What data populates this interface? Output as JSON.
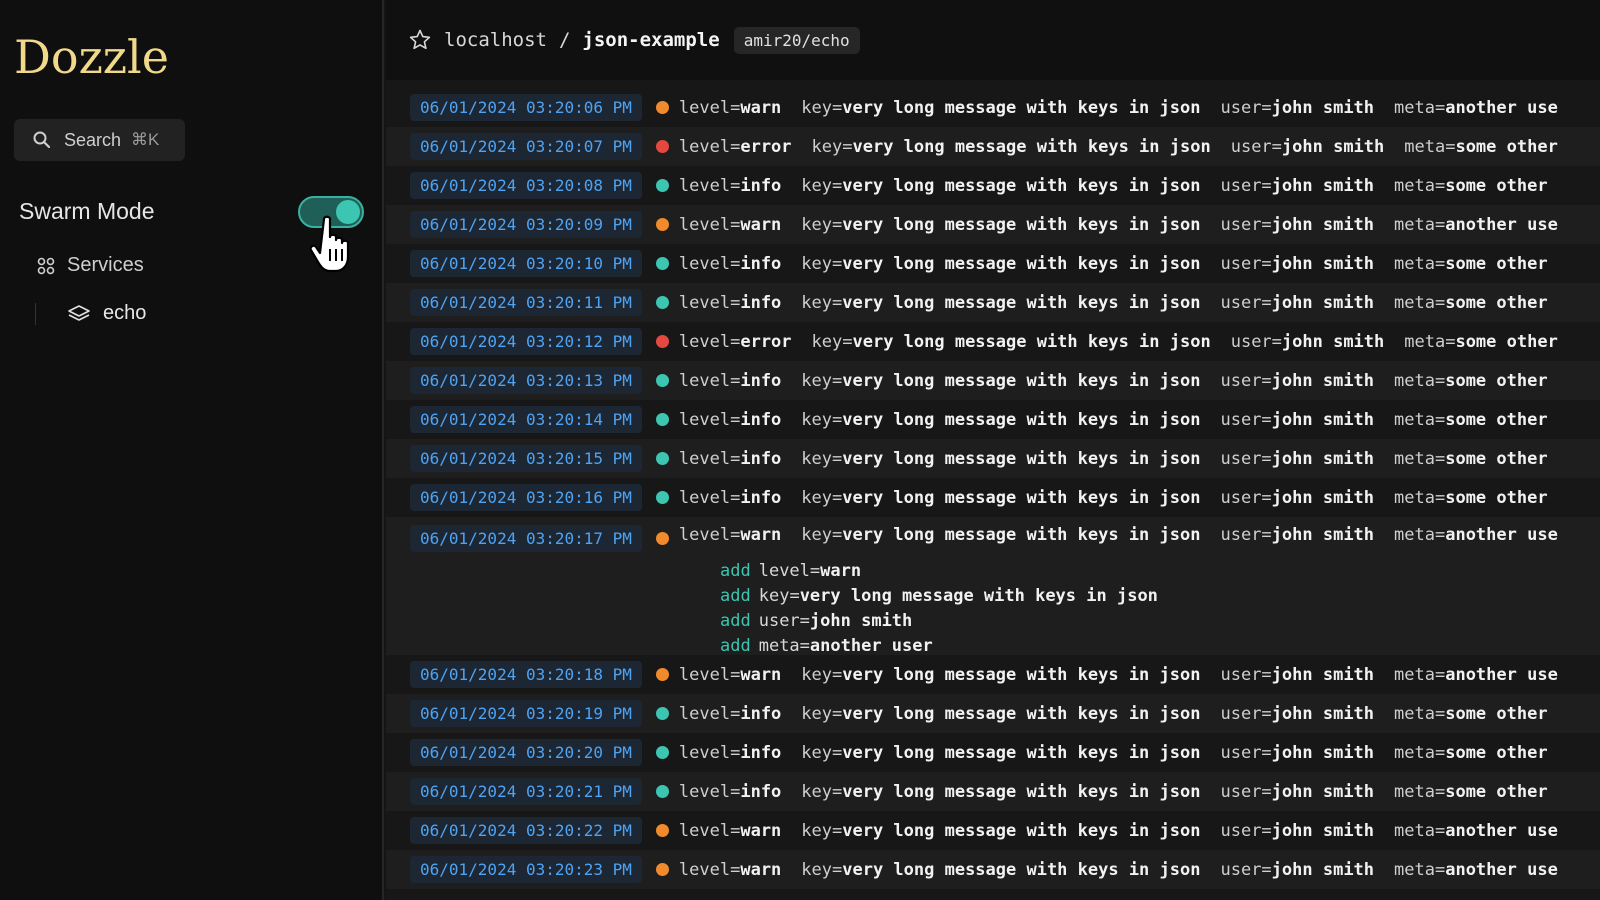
{
  "app": {
    "logo": "Dozzle"
  },
  "search": {
    "label": "Search",
    "shortcut": "⌘K"
  },
  "swarm": {
    "label": "Swarm Mode",
    "enabled": true
  },
  "nav": {
    "services_label": "Services",
    "service_item": "echo"
  },
  "header": {
    "host": "localhost",
    "separator": "/",
    "container": "json-example",
    "image": "amir20/echo"
  },
  "colors": {
    "warn": "#f08a2c",
    "error": "#e5483f",
    "info": "#3cc5b0"
  },
  "logs": [
    {
      "time": "06/01/2024 03:20:06 PM",
      "level": "warn",
      "key": "very long message with keys in json",
      "user": "john smith",
      "meta": "another use"
    },
    {
      "time": "06/01/2024 03:20:07 PM",
      "level": "error",
      "key": "very long message with keys in json",
      "user": "john smith",
      "meta": "some other"
    },
    {
      "time": "06/01/2024 03:20:08 PM",
      "level": "info",
      "key": "very long message with keys in json",
      "user": "john smith",
      "meta": "some other"
    },
    {
      "time": "06/01/2024 03:20:09 PM",
      "level": "warn",
      "key": "very long message with keys in json",
      "user": "john smith",
      "meta": "another use"
    },
    {
      "time": "06/01/2024 03:20:10 PM",
      "level": "info",
      "key": "very long message with keys in json",
      "user": "john smith",
      "meta": "some other"
    },
    {
      "time": "06/01/2024 03:20:11 PM",
      "level": "info",
      "key": "very long message with keys in json",
      "user": "john smith",
      "meta": "some other"
    },
    {
      "time": "06/01/2024 03:20:12 PM",
      "level": "error",
      "key": "very long message with keys in json",
      "user": "john smith",
      "meta": "some other"
    },
    {
      "time": "06/01/2024 03:20:13 PM",
      "level": "info",
      "key": "very long message with keys in json",
      "user": "john smith",
      "meta": "some other"
    },
    {
      "time": "06/01/2024 03:20:14 PM",
      "level": "info",
      "key": "very long message with keys in json",
      "user": "john smith",
      "meta": "some other"
    },
    {
      "time": "06/01/2024 03:20:15 PM",
      "level": "info",
      "key": "very long message with keys in json",
      "user": "john smith",
      "meta": "some other"
    },
    {
      "time": "06/01/2024 03:20:16 PM",
      "level": "info",
      "key": "very long message with keys in json",
      "user": "john smith",
      "meta": "some other"
    },
    {
      "time": "06/01/2024 03:20:17 PM",
      "level": "warn",
      "key": "very long message with keys in json",
      "user": "john smith",
      "meta": "another use",
      "expanded": [
        {
          "prefix": "add",
          "name": "level",
          "value": "warn"
        },
        {
          "prefix": "add",
          "name": "key",
          "value": "very long message with keys in json"
        },
        {
          "prefix": "add",
          "name": "user",
          "value": "john smith"
        },
        {
          "prefix": "add",
          "name": "meta",
          "value": "another user"
        }
      ]
    },
    {
      "time": "06/01/2024 03:20:18 PM",
      "level": "warn",
      "key": "very long message with keys in json",
      "user": "john smith",
      "meta": "another use"
    },
    {
      "time": "06/01/2024 03:20:19 PM",
      "level": "info",
      "key": "very long message with keys in json",
      "user": "john smith",
      "meta": "some other"
    },
    {
      "time": "06/01/2024 03:20:20 PM",
      "level": "info",
      "key": "very long message with keys in json",
      "user": "john smith",
      "meta": "some other"
    },
    {
      "time": "06/01/2024 03:20:21 PM",
      "level": "info",
      "key": "very long message with keys in json",
      "user": "john smith",
      "meta": "some other"
    },
    {
      "time": "06/01/2024 03:20:22 PM",
      "level": "warn",
      "key": "very long message with keys in json",
      "user": "john smith",
      "meta": "another use"
    },
    {
      "time": "06/01/2024 03:20:23 PM",
      "level": "warn",
      "key": "very long message with keys in json",
      "user": "john smith",
      "meta": "another use"
    }
  ]
}
